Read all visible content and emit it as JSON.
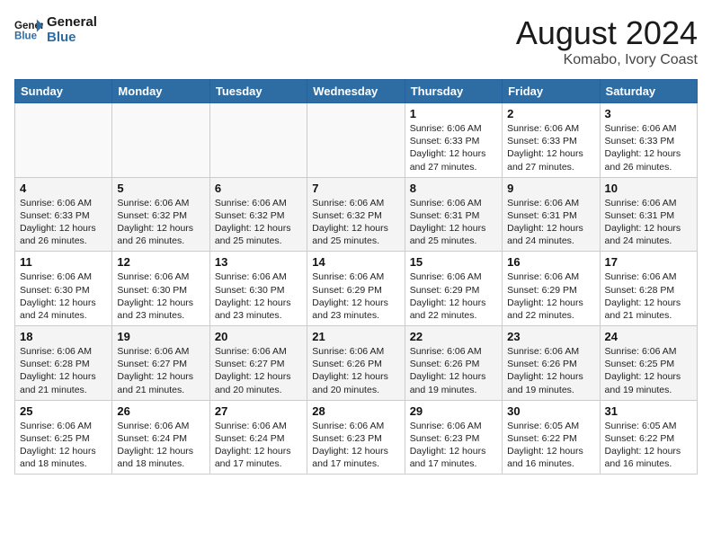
{
  "header": {
    "logo_line1": "General",
    "logo_line2": "Blue",
    "month_year": "August 2024",
    "location": "Komabo, Ivory Coast"
  },
  "weekdays": [
    "Sunday",
    "Monday",
    "Tuesday",
    "Wednesday",
    "Thursday",
    "Friday",
    "Saturday"
  ],
  "weeks": [
    [
      {
        "day": "",
        "info": ""
      },
      {
        "day": "",
        "info": ""
      },
      {
        "day": "",
        "info": ""
      },
      {
        "day": "",
        "info": ""
      },
      {
        "day": "1",
        "info": "Sunrise: 6:06 AM\nSunset: 6:33 PM\nDaylight: 12 hours\nand 27 minutes."
      },
      {
        "day": "2",
        "info": "Sunrise: 6:06 AM\nSunset: 6:33 PM\nDaylight: 12 hours\nand 27 minutes."
      },
      {
        "day": "3",
        "info": "Sunrise: 6:06 AM\nSunset: 6:33 PM\nDaylight: 12 hours\nand 26 minutes."
      }
    ],
    [
      {
        "day": "4",
        "info": "Sunrise: 6:06 AM\nSunset: 6:33 PM\nDaylight: 12 hours\nand 26 minutes."
      },
      {
        "day": "5",
        "info": "Sunrise: 6:06 AM\nSunset: 6:32 PM\nDaylight: 12 hours\nand 26 minutes."
      },
      {
        "day": "6",
        "info": "Sunrise: 6:06 AM\nSunset: 6:32 PM\nDaylight: 12 hours\nand 25 minutes."
      },
      {
        "day": "7",
        "info": "Sunrise: 6:06 AM\nSunset: 6:32 PM\nDaylight: 12 hours\nand 25 minutes."
      },
      {
        "day": "8",
        "info": "Sunrise: 6:06 AM\nSunset: 6:31 PM\nDaylight: 12 hours\nand 25 minutes."
      },
      {
        "day": "9",
        "info": "Sunrise: 6:06 AM\nSunset: 6:31 PM\nDaylight: 12 hours\nand 24 minutes."
      },
      {
        "day": "10",
        "info": "Sunrise: 6:06 AM\nSunset: 6:31 PM\nDaylight: 12 hours\nand 24 minutes."
      }
    ],
    [
      {
        "day": "11",
        "info": "Sunrise: 6:06 AM\nSunset: 6:30 PM\nDaylight: 12 hours\nand 24 minutes."
      },
      {
        "day": "12",
        "info": "Sunrise: 6:06 AM\nSunset: 6:30 PM\nDaylight: 12 hours\nand 23 minutes."
      },
      {
        "day": "13",
        "info": "Sunrise: 6:06 AM\nSunset: 6:30 PM\nDaylight: 12 hours\nand 23 minutes."
      },
      {
        "day": "14",
        "info": "Sunrise: 6:06 AM\nSunset: 6:29 PM\nDaylight: 12 hours\nand 23 minutes."
      },
      {
        "day": "15",
        "info": "Sunrise: 6:06 AM\nSunset: 6:29 PM\nDaylight: 12 hours\nand 22 minutes."
      },
      {
        "day": "16",
        "info": "Sunrise: 6:06 AM\nSunset: 6:29 PM\nDaylight: 12 hours\nand 22 minutes."
      },
      {
        "day": "17",
        "info": "Sunrise: 6:06 AM\nSunset: 6:28 PM\nDaylight: 12 hours\nand 21 minutes."
      }
    ],
    [
      {
        "day": "18",
        "info": "Sunrise: 6:06 AM\nSunset: 6:28 PM\nDaylight: 12 hours\nand 21 minutes."
      },
      {
        "day": "19",
        "info": "Sunrise: 6:06 AM\nSunset: 6:27 PM\nDaylight: 12 hours\nand 21 minutes."
      },
      {
        "day": "20",
        "info": "Sunrise: 6:06 AM\nSunset: 6:27 PM\nDaylight: 12 hours\nand 20 minutes."
      },
      {
        "day": "21",
        "info": "Sunrise: 6:06 AM\nSunset: 6:26 PM\nDaylight: 12 hours\nand 20 minutes."
      },
      {
        "day": "22",
        "info": "Sunrise: 6:06 AM\nSunset: 6:26 PM\nDaylight: 12 hours\nand 19 minutes."
      },
      {
        "day": "23",
        "info": "Sunrise: 6:06 AM\nSunset: 6:26 PM\nDaylight: 12 hours\nand 19 minutes."
      },
      {
        "day": "24",
        "info": "Sunrise: 6:06 AM\nSunset: 6:25 PM\nDaylight: 12 hours\nand 19 minutes."
      }
    ],
    [
      {
        "day": "25",
        "info": "Sunrise: 6:06 AM\nSunset: 6:25 PM\nDaylight: 12 hours\nand 18 minutes."
      },
      {
        "day": "26",
        "info": "Sunrise: 6:06 AM\nSunset: 6:24 PM\nDaylight: 12 hours\nand 18 minutes."
      },
      {
        "day": "27",
        "info": "Sunrise: 6:06 AM\nSunset: 6:24 PM\nDaylight: 12 hours\nand 17 minutes."
      },
      {
        "day": "28",
        "info": "Sunrise: 6:06 AM\nSunset: 6:23 PM\nDaylight: 12 hours\nand 17 minutes."
      },
      {
        "day": "29",
        "info": "Sunrise: 6:06 AM\nSunset: 6:23 PM\nDaylight: 12 hours\nand 17 minutes."
      },
      {
        "day": "30",
        "info": "Sunrise: 6:05 AM\nSunset: 6:22 PM\nDaylight: 12 hours\nand 16 minutes."
      },
      {
        "day": "31",
        "info": "Sunrise: 6:05 AM\nSunset: 6:22 PM\nDaylight: 12 hours\nand 16 minutes."
      }
    ]
  ]
}
